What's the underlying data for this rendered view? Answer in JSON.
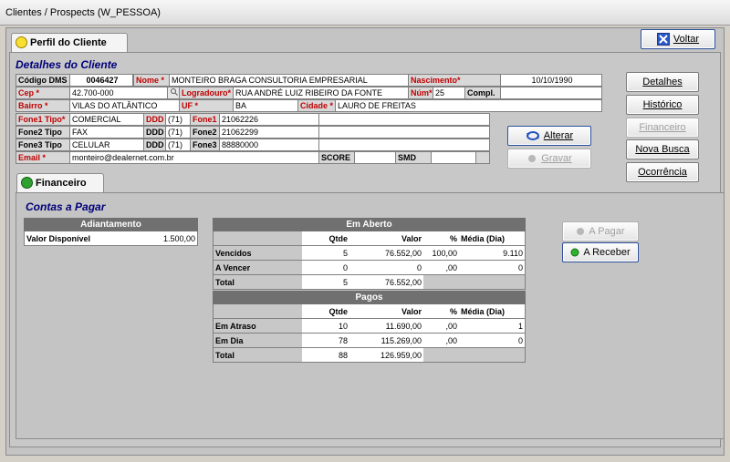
{
  "window": {
    "title": "Clientes / Prospects (W_PESSOA)"
  },
  "top_tab": "Perfil do Cliente",
  "voltar_label": "Voltar",
  "detalhes": {
    "title": "Detalhes do Cliente",
    "codigo_label": "Código DMS",
    "codigo": "0046427",
    "nome_label": "Nome *",
    "nome": "MONTEIRO BRAGA CONSULTORIA EMPRESARIAL",
    "nasc_label": "Nascimento*",
    "nasc": "10/10/1990",
    "cep_label": "Cep *",
    "cep": "42.700-000",
    "logr_label": "Logradouro*",
    "logr": "RUA ANDRÉ LUIZ RIBEIRO DA FONTE",
    "num_label": "Núm*",
    "num": "25",
    "compl_label": "Compl.",
    "compl": "",
    "bairro_label": "Bairro *",
    "bairro": "VILAS DO ATLÂNTICO",
    "uf_label": "UF *",
    "uf": "BA",
    "cidade_label": "Cidade *",
    "cidade": "LAURO DE FREITAS",
    "fone1_tipo_label": "Fone1 Tipo*",
    "fone1_tipo": "COMERCIAL",
    "ddd_label": "DDD",
    "ddd1": "(71)",
    "fone1_label": "Fone1",
    "fone1": "21062226",
    "fone2_tipo_label": "Fone2 Tipo",
    "fone2_tipo": "FAX",
    "ddd2": "(71)",
    "fone2_label": "Fone2",
    "fone2": "21062299",
    "fone3_tipo_label": "Fone3 Tipo",
    "fone3_tipo": "CELULAR",
    "ddd3": "(71)",
    "fone3_label": "Fone3",
    "fone3": "88880000",
    "email_label": "Email *",
    "email": "monteiro@dealernet.com.br",
    "score_label": "SCORE",
    "smd_label": "SMD"
  },
  "buttons": {
    "alterar": "Alterar",
    "gravar": "Gravar",
    "detalhes": "Detalhes",
    "historico": "Histórico",
    "financeiro": "Financeiro",
    "nova_busca": "Nova Busca",
    "ocorrencia": "Ocorrência",
    "a_pagar": "A Pagar",
    "a_receber": "A Receber"
  },
  "fin_tab": "Financeiro",
  "contas_title": "Contas a Pagar",
  "adiantamento": {
    "header": "Adiantamento",
    "label": "Valor Disponível",
    "value": "1.500,00"
  },
  "em_aberto": {
    "header": "Em Aberto",
    "cols": [
      "Qtde",
      "Valor",
      "%",
      "Média (Dia)"
    ],
    "rows": [
      {
        "label": "Vencidos",
        "qtde": "5",
        "valor": "76.552,00",
        "pct": "100,00",
        "media": "9.110"
      },
      {
        "label": "A Vencer",
        "qtde": "0",
        "valor": "0",
        "pct": ",00",
        "media": "0"
      },
      {
        "label": "Total",
        "qtde": "5",
        "valor": "76.552,00"
      }
    ]
  },
  "pagos": {
    "header": "Pagos",
    "cols": [
      "Qtde",
      "Valor",
      "%",
      "Média (Dia)"
    ],
    "rows": [
      {
        "label": "Em Atraso",
        "qtde": "10",
        "valor": "11.690,00",
        "pct": ",00",
        "media": "1"
      },
      {
        "label": "Em Dia",
        "qtde": "78",
        "valor": "115.269,00",
        "pct": ",00",
        "media": "0"
      },
      {
        "label": "Total",
        "qtde": "88",
        "valor": "126.959,00"
      }
    ]
  }
}
